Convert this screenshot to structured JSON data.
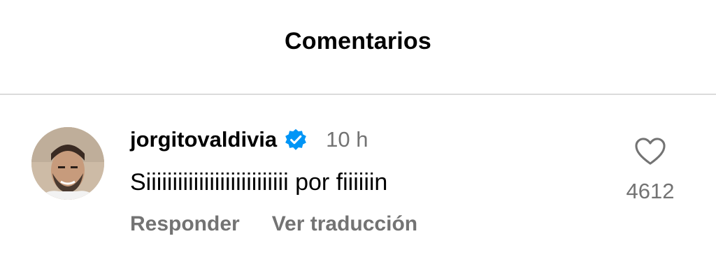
{
  "header": {
    "title": "Comentarios"
  },
  "comment": {
    "username": "jorgitovaldivia",
    "verified_icon": "verified-badge-icon",
    "timestamp": "10 h",
    "text": "Siiiiiiiiiiiiiiiiiiiiiiiiiii por fiiiiiin",
    "reply_label": "Responder",
    "translate_label": "Ver traducción",
    "like_icon": "heart-outline-icon",
    "like_count": "4612",
    "colors": {
      "verified": "#0095f6",
      "secondary_text": "#737373",
      "divider": "#dbdbdb"
    }
  }
}
